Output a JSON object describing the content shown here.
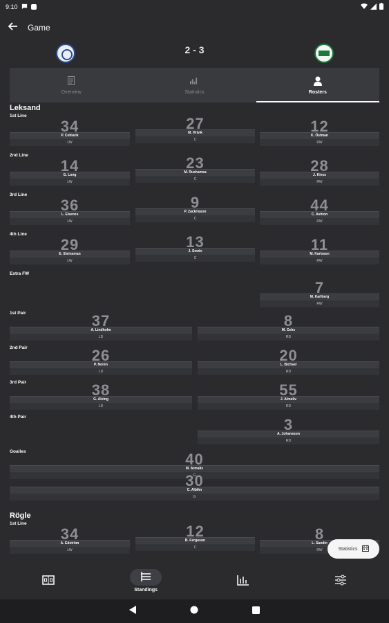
{
  "status": {
    "time": "9:10"
  },
  "appbar": {
    "title": "Game"
  },
  "game": {
    "score": "2 - 3"
  },
  "tabs": [
    {
      "label": "Overview",
      "icon": "document-icon"
    },
    {
      "label": "Statistics",
      "icon": "stats-icon"
    },
    {
      "label": "Rosters",
      "icon": "person-icon",
      "active": true
    }
  ],
  "teams": [
    {
      "name": "Leksand",
      "groups": [
        {
          "label": "1st Line",
          "players": [
            {
              "num": "34",
              "name": "P. Cehlarik",
              "pos": "LW"
            },
            {
              "num": "27",
              "name": "M. Hrivik",
              "pos": "C"
            },
            {
              "num": "12",
              "name": "K. Östman",
              "pos": "RW"
            }
          ]
        },
        {
          "label": "2nd Line",
          "players": [
            {
              "num": "14",
              "name": "G. Long",
              "pos": "LW"
            },
            {
              "num": "23",
              "name": "M. Rushamsa",
              "pos": "C"
            },
            {
              "num": "28",
              "name": "J. Kivss",
              "pos": "RW"
            }
          ]
        },
        {
          "label": "3rd Line",
          "players": [
            {
              "num": "36",
              "name": "L. Elsenes",
              "pos": "LW"
            },
            {
              "num": "9",
              "name": "P. Zackrisson",
              "pos": "C"
            },
            {
              "num": "44",
              "name": "C. Ashton",
              "pos": "RW"
            }
          ]
        },
        {
          "label": "4th Line",
          "players": [
            {
              "num": "29",
              "name": "E. Steinsman",
              "pos": "LW"
            },
            {
              "num": "13",
              "name": "J. Sewin",
              "pos": "C"
            },
            {
              "num": "11",
              "name": "M. Karlsson",
              "pos": "RW"
            }
          ]
        },
        {
          "label": "Extra FW",
          "players": [
            {
              "num": "7",
              "name": "M. Karlberg",
              "pos": "RW"
            }
          ]
        },
        {
          "label": "1st Pair",
          "players": [
            {
              "num": "37",
              "name": "A. Lindholm",
              "pos": "LD"
            },
            {
              "num": "8",
              "name": "M. Cehs",
              "pos": "RD"
            }
          ]
        },
        {
          "label": "2nd Pair",
          "players": [
            {
              "num": "26",
              "name": "P. Norén",
              "pos": "LD"
            },
            {
              "num": "20",
              "name": "L. Bichsel",
              "pos": "RD"
            }
          ]
        },
        {
          "label": "3rd Pair",
          "players": [
            {
              "num": "38",
              "name": "G. Alving",
              "pos": "LD"
            },
            {
              "num": "55",
              "name": "J. Almeliv",
              "pos": "RD"
            }
          ]
        },
        {
          "label": "4th Pair",
          "players": [
            {
              "num": "3",
              "name": "A. Johansson",
              "pos": "RD"
            }
          ]
        },
        {
          "label": "Goalies",
          "players": [
            {
              "num": "40",
              "name": "M. Armalis",
              "pos": "G"
            },
            {
              "num": "30",
              "name": "C. Albihn",
              "pos": "G"
            }
          ]
        }
      ]
    },
    {
      "name": "Rögle",
      "groups": [
        {
          "label": "1st Line",
          "players": [
            {
              "num": "34",
              "name": "A. Edström",
              "pos": "LW"
            },
            {
              "num": "12",
              "name": "B. Ferguson",
              "pos": "C"
            },
            {
              "num": "8",
              "name": "L. Sandin",
              "pos": "RW"
            }
          ]
        }
      ]
    }
  ],
  "fab": {
    "label": "Statistics",
    "icon": "calendar-icon"
  },
  "bottom_nav": [
    {
      "label": "",
      "icon": "scoreboard-icon"
    },
    {
      "label": "Standings",
      "icon": "list-icon",
      "active": true
    },
    {
      "label": "",
      "icon": "bar-chart-icon"
    },
    {
      "label": "",
      "icon": "sliders-icon"
    }
  ]
}
